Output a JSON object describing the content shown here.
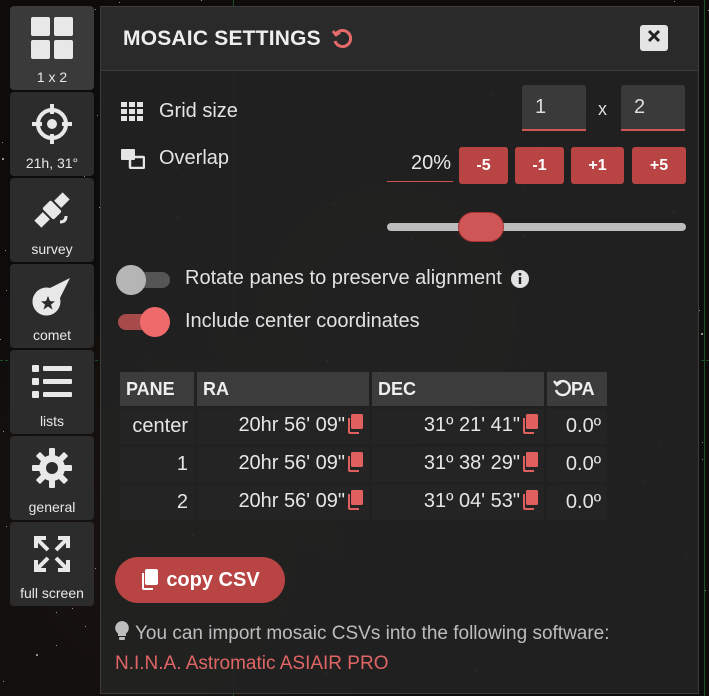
{
  "toolbar": {
    "items": [
      {
        "label": "1 x 2",
        "icon": "grid-icon"
      },
      {
        "label": "21h, 31°",
        "icon": "crosshair-icon"
      },
      {
        "label": "survey",
        "icon": "satellite-icon"
      },
      {
        "label": "comet",
        "icon": "comet-icon"
      },
      {
        "label": "lists",
        "icon": "list-icon"
      },
      {
        "label": "general",
        "icon": "gear-icon"
      },
      {
        "label": "full screen",
        "icon": "fullscreen-icon"
      }
    ]
  },
  "panel": {
    "title": "MOSAIC SETTINGS",
    "grid_size": {
      "label": "Grid size",
      "cols": "1",
      "times": "x",
      "rows": "2"
    },
    "overlap": {
      "label": "Overlap",
      "value": "20%",
      "buttons": [
        "-5",
        "-1",
        "+1",
        "+5"
      ],
      "slider_fraction": 0.3
    },
    "toggles": {
      "rotate": {
        "label": "Rotate panes to preserve alignment",
        "on": false
      },
      "center": {
        "label": "Include center coordinates",
        "on": true
      }
    },
    "table": {
      "headers": {
        "pane": "PANE",
        "ra": "RA",
        "dec": "DEC",
        "pa": "PA"
      },
      "rows": [
        {
          "pane": "center",
          "ra": "20hr 56' 09\"",
          "dec": "31º 21' 41\"",
          "pa": "0.0º"
        },
        {
          "pane": "1",
          "ra": "20hr 56' 09\"",
          "dec": "31º 38' 29\"",
          "pa": "0.0º"
        },
        {
          "pane": "2",
          "ra": "20hr 56' 09\"",
          "dec": "31º 04' 53\"",
          "pa": "0.0º"
        }
      ]
    },
    "csv_button": "copy CSV",
    "hint": {
      "text": "You can import mosaic CSVs into the following software:",
      "links": [
        "N.I.N.A.",
        "Astromatic",
        "ASIAIR PRO"
      ]
    }
  },
  "colors": {
    "accent": "#b84444",
    "panel": "#222222",
    "toggle_on": "#ef6a6a"
  }
}
